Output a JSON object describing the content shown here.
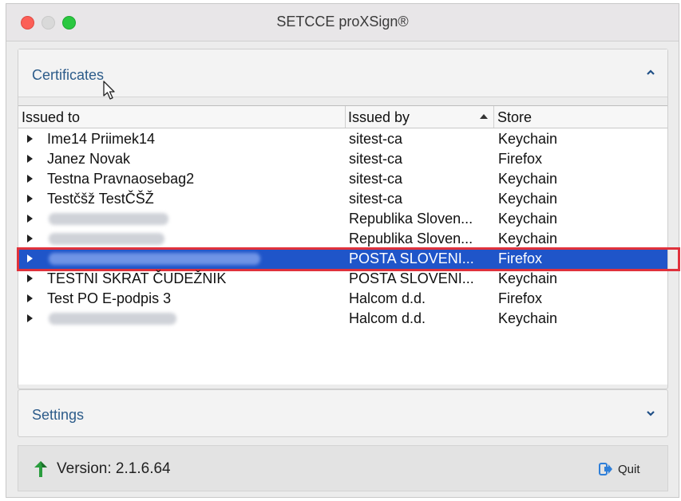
{
  "window": {
    "title": "SETCCE proXSign®"
  },
  "certificates": {
    "title": "Certificates",
    "columns": {
      "issued_to": "Issued to",
      "issued_by": "Issued by",
      "store": "Store"
    },
    "rows": [
      {
        "issued_to": "Ime14 Priimek14",
        "issued_by": "sitest-ca",
        "store": "Keychain"
      },
      {
        "issued_to": "Janez Novak",
        "issued_by": "sitest-ca",
        "store": "Firefox"
      },
      {
        "issued_to": "Testna Pravnaosebag2",
        "issued_by": "sitest-ca",
        "store": "Keychain"
      },
      {
        "issued_to": "Testčšž TestČŠŽ",
        "issued_by": "sitest-ca",
        "store": "Keychain"
      },
      {
        "issued_to": "",
        "issued_by": "Republika Sloven...",
        "store": "Keychain"
      },
      {
        "issued_to": "",
        "issued_by": "Republika Sloven...",
        "store": "Keychain"
      },
      {
        "issued_to": "",
        "issued_by": "POSTA SLOVENI...",
        "store": "Firefox"
      },
      {
        "issued_to": "TESTNI SKRAT ČUDEŽNIK",
        "issued_by": "POSTA SLOVENI...",
        "store": "Keychain"
      },
      {
        "issued_to": "Test PO E-podpis 3",
        "issued_by": "Halcom d.d.",
        "store": "Firefox"
      },
      {
        "issued_to": "",
        "issued_by": "Halcom d.d.",
        "store": "Keychain"
      }
    ]
  },
  "settings": {
    "title": "Settings"
  },
  "footer": {
    "version": "Version: 2.1.6.64",
    "quit_label": "Quit"
  },
  "colors": {
    "selection": "#1f55c9",
    "highlight_outline": "#e0323c",
    "header_text": "#2d5c8a"
  }
}
